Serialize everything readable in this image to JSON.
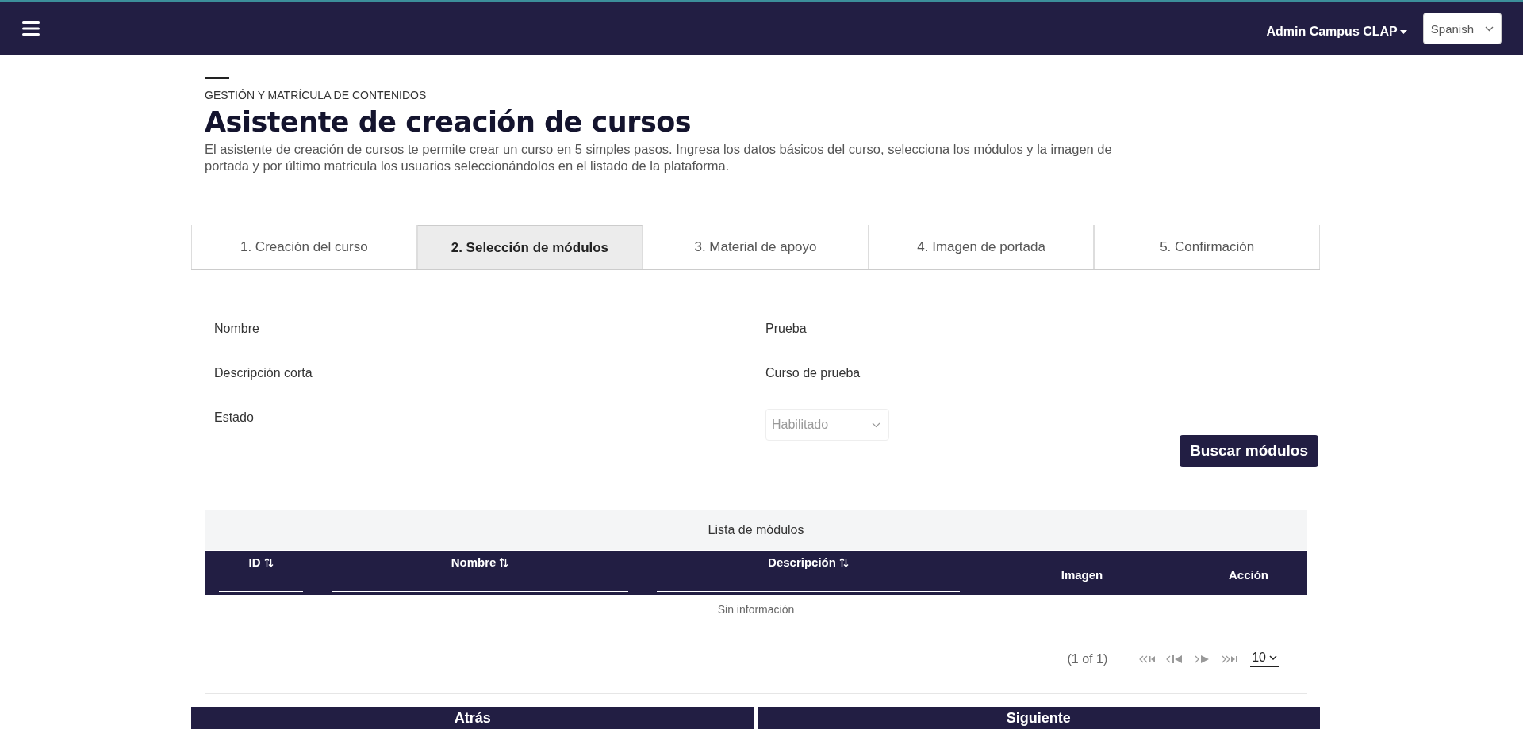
{
  "navbar": {
    "user": "Admin Campus CLAP",
    "language": "Spanish"
  },
  "header": {
    "section": "GESTIÓN Y MATRÍCULA DE CONTENIDOS",
    "title": "Asistente de creación de cursos",
    "description": "El asistente de creación de cursos te permite crear un curso en 5 simples pasos. Ingresa los datos básicos del curso, selecciona los módulos y la imagen de portada y por último matricula los usuarios seleccionándolos en el listado de la plataforma."
  },
  "tabs": [
    {
      "label": "1. Creación del curso",
      "selected": false
    },
    {
      "label": "2. Selección de módulos",
      "selected": true
    },
    {
      "label": "3. Material de apoyo",
      "selected": false
    },
    {
      "label": "4. Imagen de portada",
      "selected": false
    },
    {
      "label": "5. Confirmación",
      "selected": false
    }
  ],
  "fields": [
    {
      "label": "Nombre",
      "kind": "text",
      "value": "Prueba"
    },
    {
      "label": "Descripción corta",
      "kind": "text",
      "value": "Curso de prueba"
    },
    {
      "label": "Estado",
      "kind": "select",
      "value": "Habilitado",
      "disabled": true
    }
  ],
  "search_button": "Buscar módulos",
  "table": {
    "caption": "Lista de módulos",
    "columns": [
      {
        "label": "ID",
        "sortable": true
      },
      {
        "label": "Nombre",
        "sortable": true
      },
      {
        "label": "Descripción",
        "sortable": true
      },
      {
        "label": "Imagen",
        "sortable": false
      },
      {
        "label": "Acción",
        "sortable": false
      }
    ],
    "empty": "Sin información",
    "pagination": {
      "page_info": "(1 of 1)",
      "rows_per_page": "10"
    }
  },
  "buttons": [
    "Atrás",
    "Siguiente"
  ]
}
